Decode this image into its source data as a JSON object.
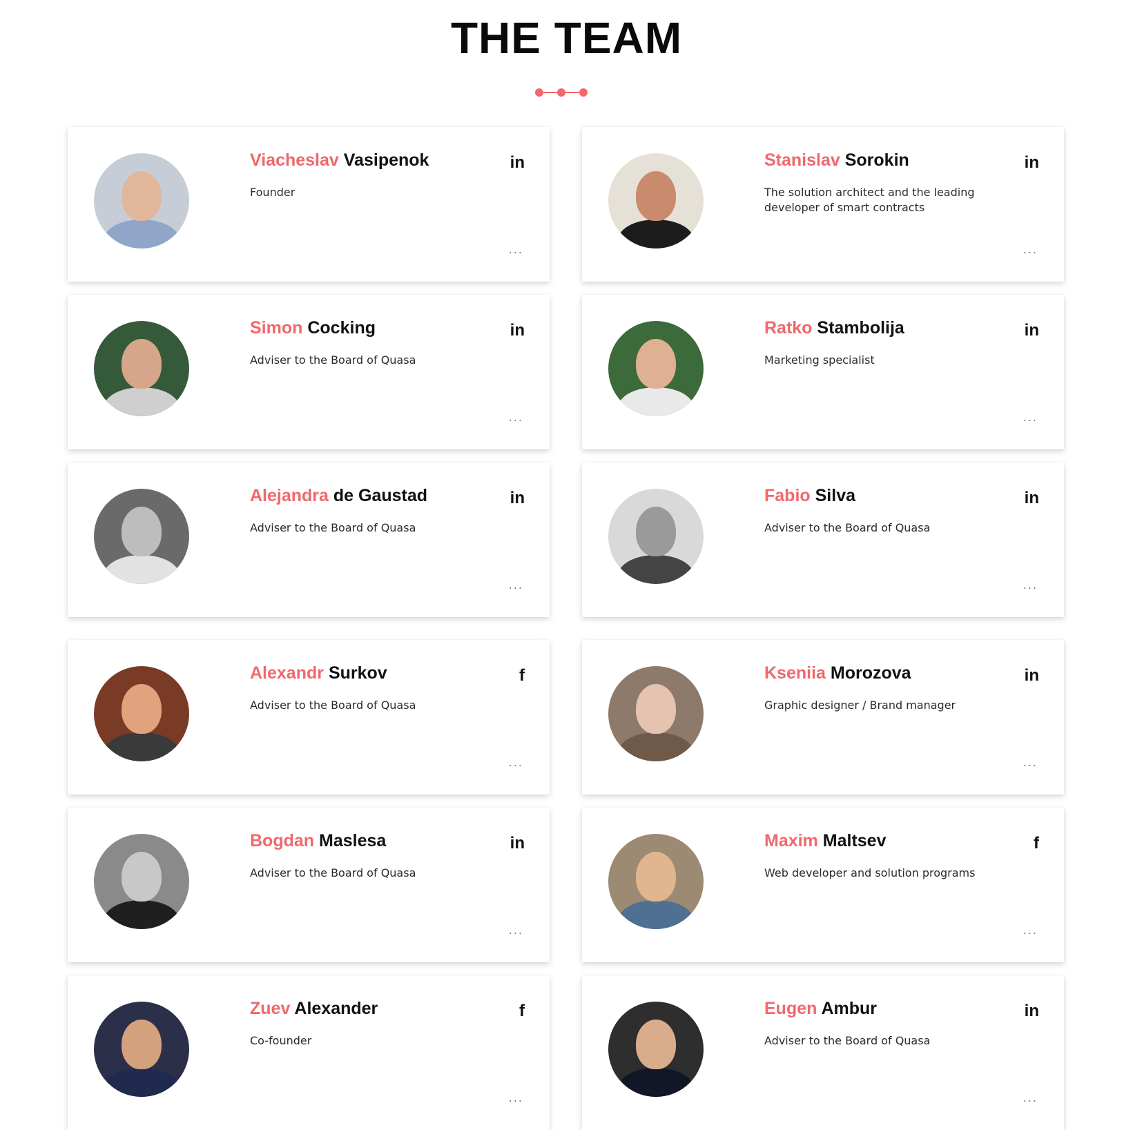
{
  "header": {
    "title": "THE TEAM"
  },
  "colors": {
    "accent": "#f0686c",
    "text": "#111111"
  },
  "members": [
    {
      "first": "Viacheslav",
      "last": "Vasipenok",
      "role": "Founder",
      "social": "in",
      "social_icon": "linkedin-icon",
      "more": "...",
      "photo": "grayscale-false"
    },
    {
      "first": "Stanislav",
      "last": "Sorokin",
      "role": "The solution architect and the leading developer of smart contracts",
      "social": "in",
      "social_icon": "linkedin-icon",
      "more": "..."
    },
    {
      "first": "Simon",
      "last": "Cocking",
      "role": "Adviser to the Board of Quasa",
      "social": "in",
      "social_icon": "linkedin-icon",
      "more": "..."
    },
    {
      "first": "Ratko",
      "last": "Stambolija",
      "role": "Marketing specialist",
      "social": "in",
      "social_icon": "linkedin-icon",
      "more": "..."
    },
    {
      "first": "Alejandra",
      "last": "de Gaustad",
      "role": "Adviser to the Board of Quasa",
      "social": "in",
      "social_icon": "linkedin-icon",
      "more": "..."
    },
    {
      "first": "Fabio",
      "last": "Silva",
      "role": "Adviser to the Board of Quasa",
      "social": "in",
      "social_icon": "linkedin-icon",
      "more": "..."
    },
    {
      "first": "Alexandr",
      "last": "Surkov",
      "role": "Adviser to the Board of Quasa",
      "social": "f",
      "social_icon": "facebook-icon",
      "more": "..."
    },
    {
      "first": "Kseniia",
      "last": "Morozova",
      "role": "Graphic designer / Brand manager",
      "social": "in",
      "social_icon": "linkedin-icon",
      "more": "..."
    },
    {
      "first": "Bogdan",
      "last": "Maslesa",
      "role": "Adviser to the Board of Quasa",
      "social": "in",
      "social_icon": "linkedin-icon",
      "more": "..."
    },
    {
      "first": "Maxim",
      "last": "Maltsev",
      "role": "Web developer and solution programs",
      "social": "f",
      "social_icon": "facebook-icon",
      "more": "..."
    },
    {
      "first": "Zuev",
      "last": "Alexander",
      "role": "Co-founder",
      "social": "f",
      "social_icon": "facebook-icon",
      "more": "..."
    },
    {
      "first": "Eugen",
      "last": "Ambur",
      "role": "Adviser to the Board of Quasa",
      "social": "in",
      "social_icon": "linkedin-icon",
      "more": "..."
    }
  ]
}
